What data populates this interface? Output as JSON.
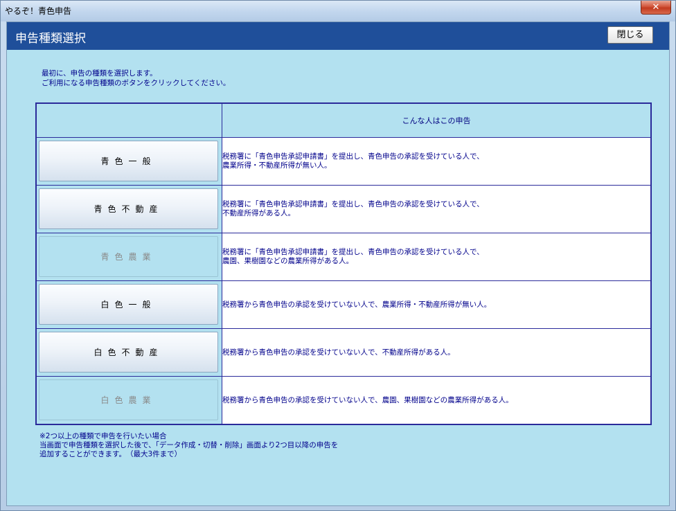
{
  "window": {
    "title": "やるぞ！青色申告",
    "close_glyph": "✕"
  },
  "header": {
    "title": "申告種類選択",
    "close_label": "閉じる"
  },
  "intro": {
    "line1": "最初に、申告の種類を選択します。",
    "line2": "ご利用になる申告種類のボタンをクリックしてください。"
  },
  "table": {
    "column_header": "こんな人はこの申告",
    "rows": [
      {
        "button": "青色一般",
        "enabled": true,
        "desc1": "税務署に「青色申告承認申請書」を提出し、青色申告の承認を受けている人で、",
        "desc2": "農業所得・不動産所得が無い人。"
      },
      {
        "button": "青色不動産",
        "enabled": true,
        "desc1": "税務署に「青色申告承認申請書」を提出し、青色申告の承認を受けている人で、",
        "desc2": "不動産所得がある人。"
      },
      {
        "button": "青色農業",
        "enabled": false,
        "desc1": "税務署に「青色申告承認申請書」を提出し、青色申告の承認を受けている人で、",
        "desc2": "農園、果樹園などの農業所得がある人。"
      },
      {
        "button": "白色一般",
        "enabled": true,
        "desc1": "税務署から青色申告の承認を受けていない人で、農業所得・不動産所得が無い人。",
        "desc2": ""
      },
      {
        "button": "白色不動産",
        "enabled": true,
        "desc1": "税務署から青色申告の承認を受けていない人で、不動産所得がある人。",
        "desc2": ""
      },
      {
        "button": "白色農業",
        "enabled": false,
        "desc1": "税務署から青色申告の承認を受けていない人で、農園、果樹園などの農業所得がある人。",
        "desc2": ""
      }
    ]
  },
  "notes": {
    "line1": "※2つ以上の種類で申告を行いたい場合",
    "line2": "当画面で申告種類を選択した後で、「データ作成・切替・削除」画面より2つ目以降の申告を",
    "line3": "追加することができます。　（最大3件まで）"
  }
}
